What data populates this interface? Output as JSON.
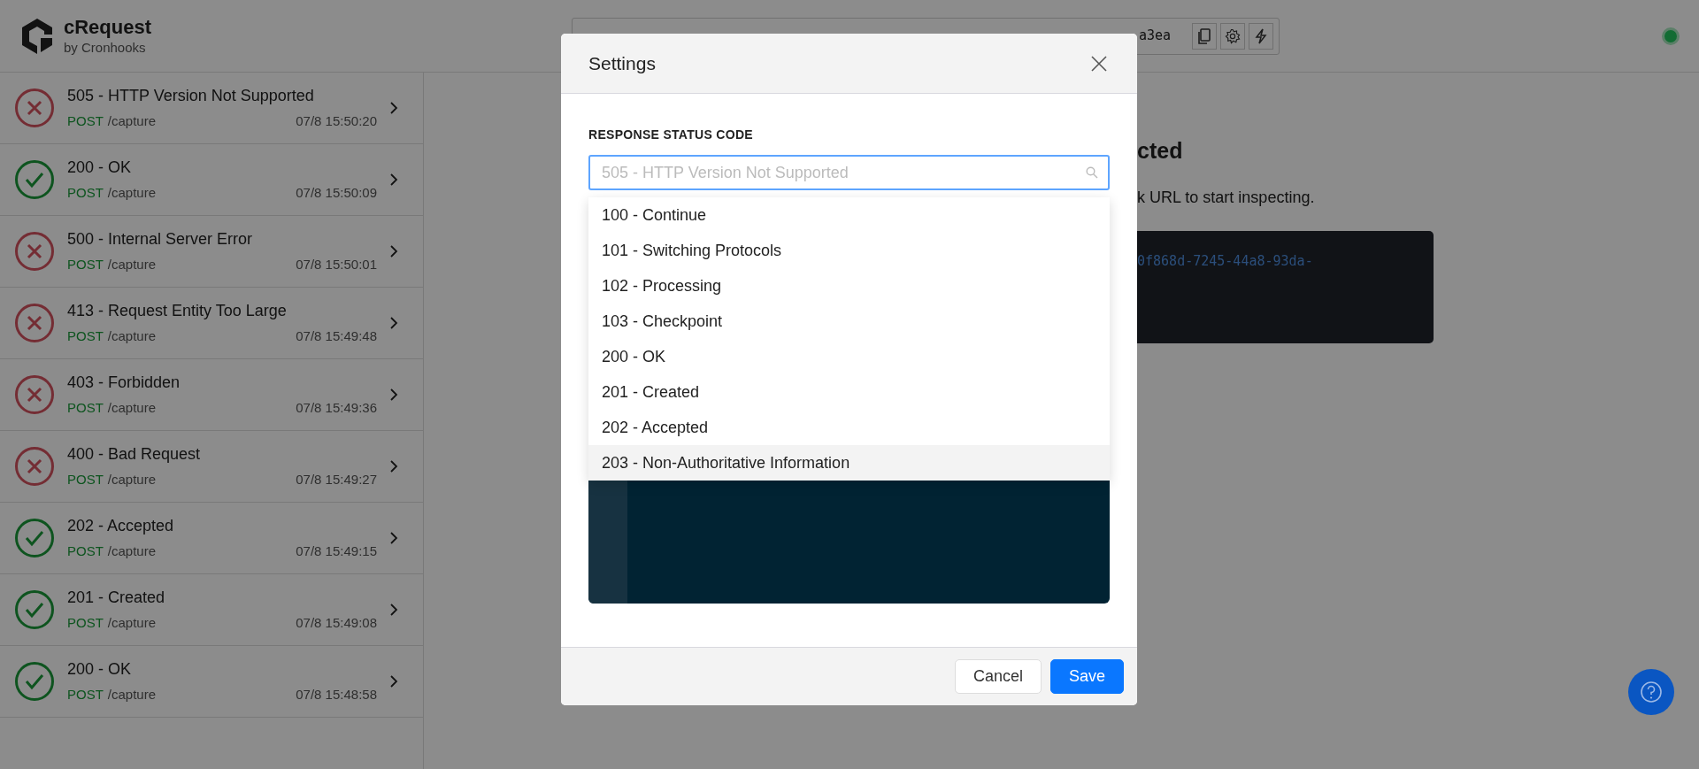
{
  "header": {
    "app_name": "cRequest",
    "byline": "by Cronhooks",
    "url_visible": "a3ea",
    "connected": true
  },
  "requests": [
    {
      "title": "505 - HTTP Version Not Supported",
      "method": "POST",
      "path": "/capture",
      "time": "07/8 15:50:20",
      "kind": "error"
    },
    {
      "title": "200 - OK",
      "method": "POST",
      "path": "/capture",
      "time": "07/8 15:50:09",
      "kind": "success"
    },
    {
      "title": "500 - Internal Server Error",
      "method": "POST",
      "path": "/capture",
      "time": "07/8 15:50:01",
      "kind": "error"
    },
    {
      "title": "413 - Request Entity Too Large",
      "method": "POST",
      "path": "/capture",
      "time": "07/8 15:49:48",
      "kind": "error"
    },
    {
      "title": "403 - Forbidden",
      "method": "POST",
      "path": "/capture",
      "time": "07/8 15:49:36",
      "kind": "error"
    },
    {
      "title": "400 - Bad Request",
      "method": "POST",
      "path": "/capture",
      "time": "07/8 15:49:27",
      "kind": "error"
    },
    {
      "title": "202 - Accepted",
      "method": "POST",
      "path": "/capture",
      "time": "07/8 15:49:15",
      "kind": "success"
    },
    {
      "title": "201 - Created",
      "method": "POST",
      "path": "/capture",
      "time": "07/8 15:49:08",
      "kind": "success"
    },
    {
      "title": "200 - OK",
      "method": "POST",
      "path": "/capture",
      "time": "07/8 15:48:58",
      "kind": "success"
    }
  ],
  "main": {
    "heading": "cted",
    "text": "k URL to start inspecting.",
    "code": "0f868d-7245-44a8-93da-"
  },
  "dialog": {
    "title": "Settings",
    "field_label": "RESPONSE STATUS CODE",
    "placeholder": "505 - HTTP Version Not Supported",
    "options": [
      {
        "label": "100 - Continue",
        "highlighted": false
      },
      {
        "label": "101 - Switching Protocols",
        "highlighted": false
      },
      {
        "label": "102 - Processing",
        "highlighted": false
      },
      {
        "label": "103 - Checkpoint",
        "highlighted": false
      },
      {
        "label": "200 - OK",
        "highlighted": false
      },
      {
        "label": "201 - Created",
        "highlighted": false
      },
      {
        "label": "202 - Accepted",
        "highlighted": false
      },
      {
        "label": "203 - Non-Authoritative Information",
        "highlighted": true
      }
    ],
    "buttons": [
      {
        "label": "Cancel",
        "kind": "secondary"
      },
      {
        "label": "Save",
        "kind": "primary"
      }
    ]
  }
}
